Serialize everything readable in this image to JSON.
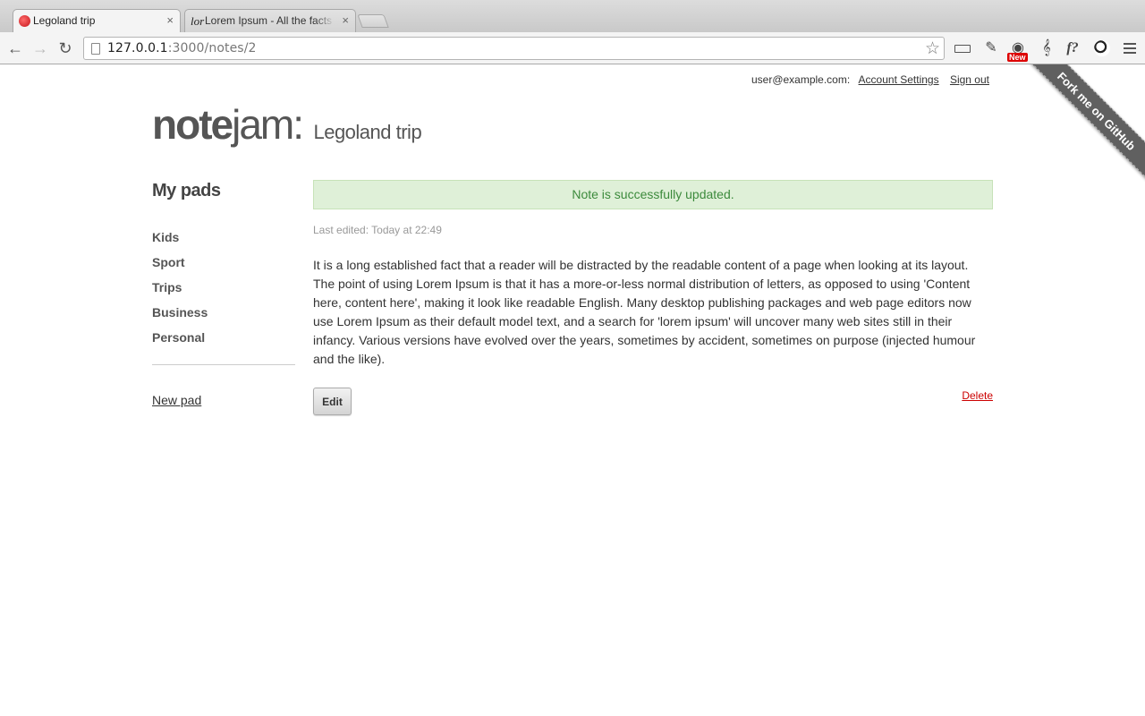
{
  "browser": {
    "tabs": [
      {
        "title": "Legoland trip",
        "favicon": "notejam-favicon"
      },
      {
        "title": "Lorem Ipsum - All the facts - Lipsum generator",
        "favicon": "lorem-favicon",
        "favicon_text": "lor"
      }
    ],
    "close_glyph": "×",
    "url_host": "127.0.0.1",
    "url_rest": ":3000/notes/2",
    "extension_badge": "New",
    "ext_music_glyph": "𝄞",
    "ext_fx_glyph": "f?"
  },
  "header": {
    "user_email": "user@example.com:",
    "account_settings": "Account Settings",
    "sign_out": "Sign out",
    "logo_bold": "note",
    "logo_light": "jam:",
    "pad_title": "Legoland trip",
    "ribbon": "Fork me on GitHub"
  },
  "sidebar": {
    "title": "My pads",
    "pads": [
      "Kids",
      "Sport",
      "Trips",
      "Business",
      "Personal"
    ],
    "new_pad": "New pad"
  },
  "note": {
    "alert": "Note is successfully updated.",
    "last_edited": "Last edited: Today at 22:49",
    "text": "It is a long established fact that a reader will be distracted by the readable content of a page when looking at its layout. The point of using Lorem Ipsum is that it has a more-or-less normal distribution of letters, as opposed to using 'Content here, content here', making it look like readable English. Many desktop publishing packages and web page editors now use Lorem Ipsum as their default model text, and a search for 'lorem ipsum' will uncover many web sites still in their infancy. Various versions have evolved over the years, sometimes by accident, sometimes on purpose (injected humour and the like).",
    "edit_label": "Edit",
    "delete_label": "Delete"
  },
  "colors": {
    "alert_bg": "#dff0d8",
    "alert_text": "#3c8a3c",
    "delete_link": "#cc0000",
    "ribbon": "#606060"
  }
}
